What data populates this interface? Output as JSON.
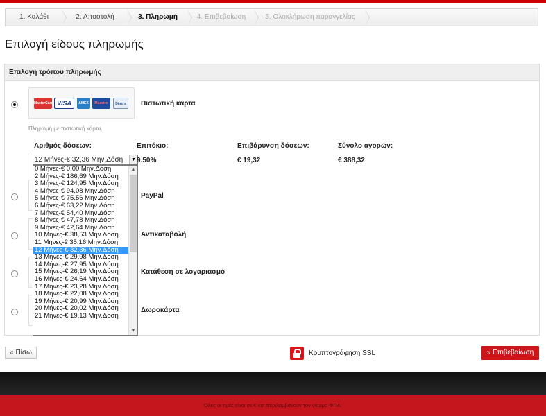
{
  "steps": [
    {
      "label": "1. Καλάθι"
    },
    {
      "label": "2. Αποστολή"
    },
    {
      "label": "3. Πληρωμή"
    },
    {
      "label": "4. Επιβεβαίωση"
    },
    {
      "label": "5. Ολοκλήρωση παραγγελίας"
    }
  ],
  "page_title": "Επιλογή είδους πληρωμής",
  "payment_box": {
    "header": "Επιλογή τρόπου πληρωμής",
    "card_logos": [
      "MasterCard",
      "VISA",
      "AMEX",
      "Maestro",
      "Diners"
    ],
    "methods": [
      {
        "label": "Πιστωτική κάρτα",
        "selected": true
      },
      {
        "label": "PayPal",
        "selected": false
      },
      {
        "label": "Αντικαταβολή",
        "selected": false
      },
      {
        "label": "Κατάθεση σε λογαριασμό",
        "selected": false
      },
      {
        "label": "Δωροκάρτα",
        "selected": false
      }
    ],
    "card_description": "Πληρωμή με πιστωτική κάρτα.",
    "installments": {
      "headers": {
        "count": "Αριθμός δόσεων:",
        "interest": "Επιτόκιο:",
        "surcharge": "Επιβάρυνση δόσεων:",
        "total": "Σύνολο αγορών:"
      },
      "selected_value": "12 Μήνες-€ 32,36 Μην.Δόση",
      "interest": "9.50%",
      "surcharge": "€ 19,32",
      "total": "€ 388,32",
      "options": [
        "0 Μήνες-€ 0,00 Μην.Δόση",
        "2 Μήνες-€ 186,69 Μην.Δόση",
        "3 Μήνες-€ 124,95 Μην.Δόση",
        "4 Μήνες-€ 94,08 Μην.Δόση",
        "5 Μήνες-€ 75,56 Μην.Δόση",
        "6 Μήνες-€ 63,22 Μην.Δόση",
        "7 Μήνες-€ 54,40 Μην.Δόση",
        "8 Μήνες-€ 47,78 Μην.Δόση",
        "9 Μήνες-€ 42,64 Μην.Δόση",
        "10 Μήνες-€ 38,53 Μην.Δόση",
        "11 Μήνες-€ 35,16 Μην.Δόση",
        "12 Μήνες-€ 32,36 Μην.Δόση",
        "13 Μήνες-€ 29,98 Μην.Δόση",
        "14 Μήνες-€ 27,95 Μην.Δόση",
        "15 Μήνες-€ 26,19 Μην.Δόση",
        "16 Μήνες-€ 24,64 Μην.Δόση",
        "17 Μήνες-€ 23,28 Μην.Δόση",
        "18 Μήνες-€ 22,08 Μην.Δόση",
        "19 Μήνες-€ 20,99 Μην.Δόση",
        "20 Μήνες-€ 20,02 Μην.Δόση",
        "21 Μήνες-€ 19,13 Μην.Δόση"
      ],
      "selected_index": 11
    }
  },
  "actions": {
    "back": "« Πίσω",
    "ssl": "Κρυπτογράφηση SSL",
    "confirm": "» Επιβεβαίωση"
  },
  "footer": {
    "notice": "Όλες οι τιμές είναι σε € και περιλαμβάνουν τον νόμιμο ΦΠΑ."
  },
  "colors": {
    "accent_red": "#cd1619",
    "selection_blue": "#3399ff",
    "footer_dark": "#1a1a1a"
  }
}
